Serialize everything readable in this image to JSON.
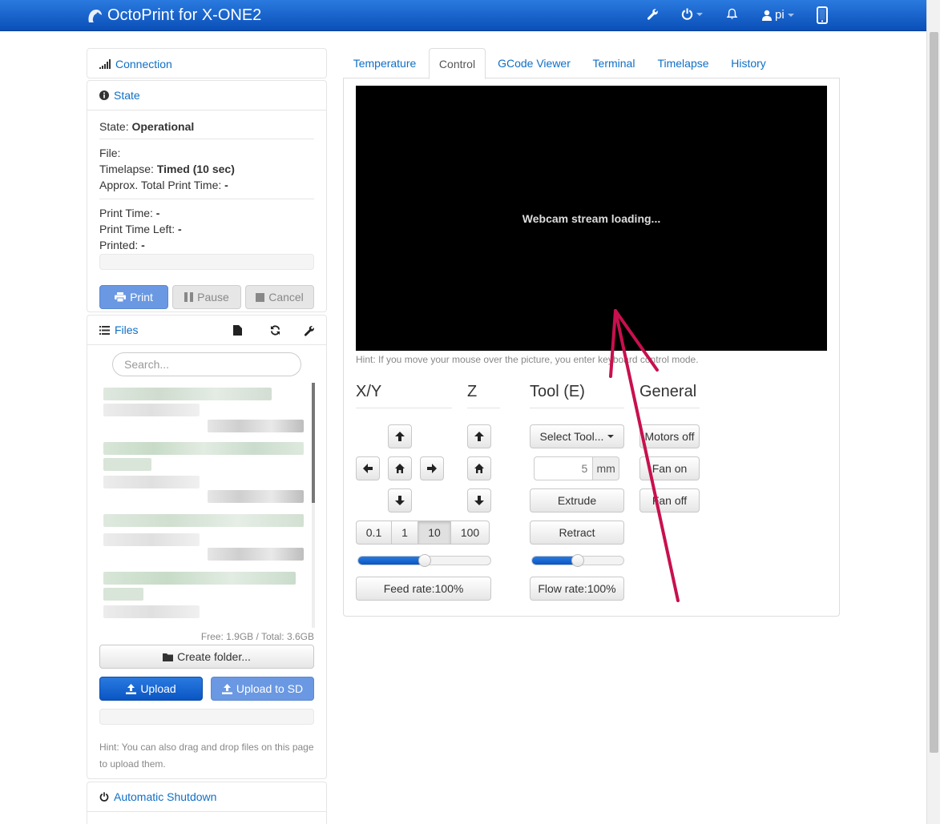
{
  "navbar": {
    "brand": "OctoPrint for X-ONE2",
    "user": "pi"
  },
  "sidebar": {
    "connection": {
      "title": "Connection"
    },
    "state": {
      "title": "State",
      "state_label": "State:",
      "state_value": "Operational",
      "file_label": "File:",
      "timelapse_label": "Timelapse:",
      "timelapse_value": "Timed (10 sec)",
      "approx_label": "Approx. Total Print Time:",
      "approx_value": "-",
      "print_time_label": "Print Time:",
      "print_time_value": "-",
      "time_left_label": "Print Time Left:",
      "time_left_value": "-",
      "printed_label": "Printed:",
      "printed_value": "-",
      "print_button": "Print",
      "pause_button": "Pause",
      "cancel_button": "Cancel"
    },
    "files": {
      "title": "Files",
      "search_placeholder": "Search...",
      "free_total": "Free: 1.9GB / Total: 3.6GB",
      "create_folder": "Create folder...",
      "upload": "Upload",
      "upload_sd": "Upload to SD",
      "hint": "Hint: You can also drag and drop files on this page to upload them."
    },
    "shutdown": {
      "title": "Automatic Shutdown"
    }
  },
  "tabs": [
    "Temperature",
    "Control",
    "GCode Viewer",
    "Terminal",
    "Timelapse",
    "History"
  ],
  "active_tab": "Control",
  "control": {
    "webcam_loading": "Webcam stream loading...",
    "webcam_hint": "Hint: If you move your mouse over the picture, you enter keyboard control mode.",
    "xy_title": "X/Y",
    "z_title": "Z",
    "tool_title": "Tool (E)",
    "general_title": "General",
    "steps": [
      "0.1",
      "1",
      "10",
      "100"
    ],
    "active_step": "10",
    "feed_rate": "Feed rate:100%",
    "feed_rate_value": 0.5,
    "flow_rate": "Flow rate:100%",
    "flow_rate_value": 0.5,
    "select_tool": "Select Tool...",
    "extrude_amount": "5",
    "extrude_unit": "mm",
    "extrude": "Extrude",
    "retract": "Retract",
    "motors_off": "Motors off",
    "fan_on": "Fan on",
    "fan_off": "Fan off"
  },
  "colors": {
    "accent": "#0f6fc6",
    "annotation_arrow": "#c8104e"
  }
}
